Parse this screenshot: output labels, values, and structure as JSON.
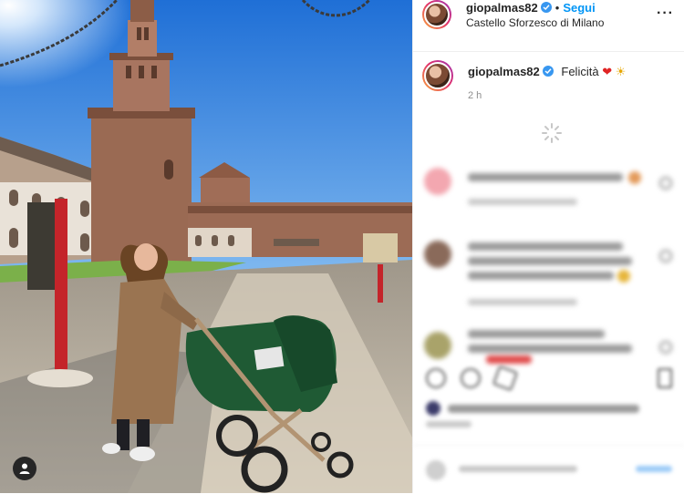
{
  "post": {
    "username": "giopalmas82",
    "follow_label": "Segui",
    "location": "Castello Sforzesco di Milano",
    "more_label": "···"
  },
  "caption": {
    "username": "giopalmas82",
    "text": "Felicità",
    "emoji_heart": "❤",
    "emoji_sun": "☀",
    "time": "2 h"
  },
  "colors": {
    "accent": "#0095f6",
    "verified": "#3897f0",
    "sky": "#2a7be0",
    "brick": "#8a5a44"
  },
  "icons": {
    "verified": "verified-badge-icon",
    "tag": "user-tag-icon",
    "spinner": "loading-spinner-icon"
  }
}
